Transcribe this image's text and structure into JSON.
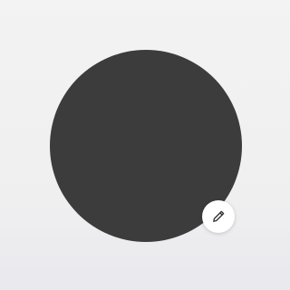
{
  "avatar": {
    "color": "#3c3c3c"
  },
  "edit_button": {
    "icon": "pencil-icon",
    "background": "#ffffff",
    "icon_color": "#333333"
  }
}
